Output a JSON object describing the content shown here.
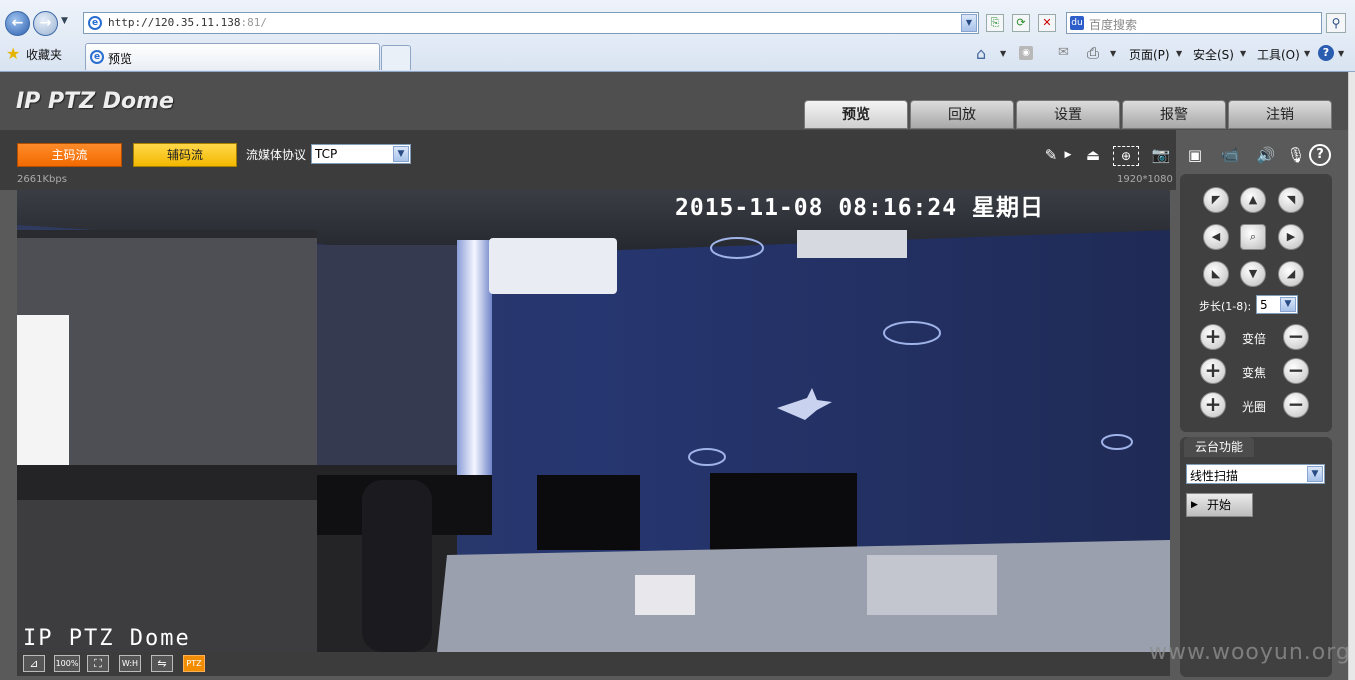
{
  "browser": {
    "address": {
      "url_main": "http://120.35.11.138",
      "url_port": ":81/"
    },
    "search": {
      "placeholder": "百度搜索"
    },
    "favorites_label": "收藏夹",
    "tab_label": "预览",
    "commands": {
      "page": "页面(P)",
      "safety": "安全(S)",
      "tools": "工具(O)"
    }
  },
  "app": {
    "logo": "IP PTZ Dome",
    "nav": [
      "预览",
      "回放",
      "设置",
      "报警",
      "注销"
    ],
    "toolbar": {
      "main_stream": "主码流",
      "sub_stream": "辅码流",
      "protocol_label": "流媒体协议",
      "protocol_value": "TCP",
      "bitrate": "2661Kbps",
      "resolution": "1920*1080"
    },
    "video": {
      "osd_datetime": "2015-11-08 08:16:24 星期日",
      "osd_title": "IP PTZ Dome"
    },
    "videobar": [
      "100%",
      "W:H",
      "PTZ"
    ],
    "ptz": {
      "step_label": "步长(1-8):",
      "step_value": "5",
      "zoom_label": "变倍",
      "focus_label": "变焦",
      "iris_label": "光圈"
    },
    "ptz_function": {
      "tab": "云台功能",
      "mode": "线性扫描",
      "start": "开始"
    }
  },
  "watermark": "www.wooyun.org",
  "colors": {
    "main_stream": "#f26a00",
    "sub_stream": "#f3b800",
    "ptz_active": "#f28c00"
  }
}
